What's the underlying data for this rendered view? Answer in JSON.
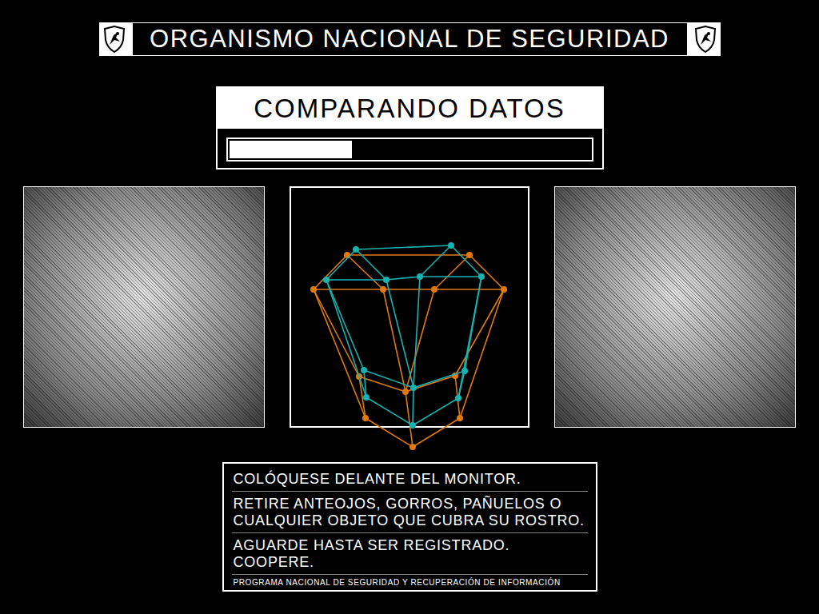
{
  "header": {
    "title": "ORGANISMO NACIONAL DE SEGURIDAD"
  },
  "status": {
    "title": "COMPARANDO DATOS",
    "level": 0.34
  },
  "meshes": [
    {
      "color": "#e07a10"
    },
    {
      "color": "#17b3b0"
    }
  ],
  "instructions": [
    "COLÓQUESE DELANTE DEL MONITOR.",
    "RETIRE ANTEOJOS, GORROS, PAÑUELOS O CUALQUIER OBJETO QUE CUBRA SU ROSTRO.",
    "AGUARDE HASTA SER REGISTRADO. COOPERE."
  ],
  "footer": "PROGRAMA NACIONAL DE SEGURIDAD Y RECUPERACIÓN DE INFORMACIÓN"
}
